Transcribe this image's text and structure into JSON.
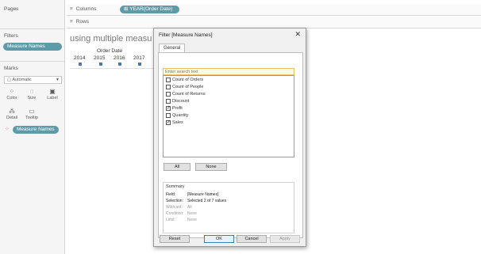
{
  "left_pane": {
    "pages": "Pages",
    "filters": "Filters",
    "filter_pill": "Measure Names",
    "marks": "Marks",
    "mark_type": "Automatic",
    "buttons": [
      "Color",
      "Size",
      "Label",
      "Detail",
      "Tooltip"
    ],
    "marks_pill": "Measure Names"
  },
  "shelves": {
    "columns_icon": "≡",
    "columns": "Columns",
    "columns_pill": "YEAR(Order Date)",
    "rows_icon": "≡",
    "rows": "Rows"
  },
  "viz": {
    "title": "using multiple measu",
    "header": "Order Date",
    "years": [
      "2014",
      "2015",
      "2016",
      "2017"
    ]
  },
  "dialog": {
    "title": "Filter [Measure Names]",
    "close": "✕",
    "tab": "General",
    "search_placeholder": "Enter search text",
    "items": [
      {
        "label": "Count of Orders",
        "checked": false
      },
      {
        "label": "Count of People",
        "checked": false
      },
      {
        "label": "Count of Returns",
        "checked": false
      },
      {
        "label": "Discount",
        "checked": false
      },
      {
        "label": "Profit",
        "checked": true
      },
      {
        "label": "Quantity",
        "checked": false
      },
      {
        "label": "Sales",
        "checked": true
      }
    ],
    "all_btn": "All",
    "none_btn": "None",
    "summary": {
      "title": "Summary",
      "field_k": "Field:",
      "field_v": "[Measure Names]",
      "selection_k": "Selection:",
      "selection_v": "Selected 2 of 7 values",
      "wildcard_k": "Wildcard:",
      "wildcard_v": "All",
      "condition_k": "Condition:",
      "condition_v": "None",
      "limit_k": "Limit:",
      "limit_v": "None"
    },
    "reset": "Reset",
    "ok": "OK",
    "cancel": "Cancel",
    "apply": "Apply"
  },
  "colors": {
    "pill": "#5f9aa9",
    "mark": "#4e79a7",
    "search_border": "#e3c45a"
  }
}
